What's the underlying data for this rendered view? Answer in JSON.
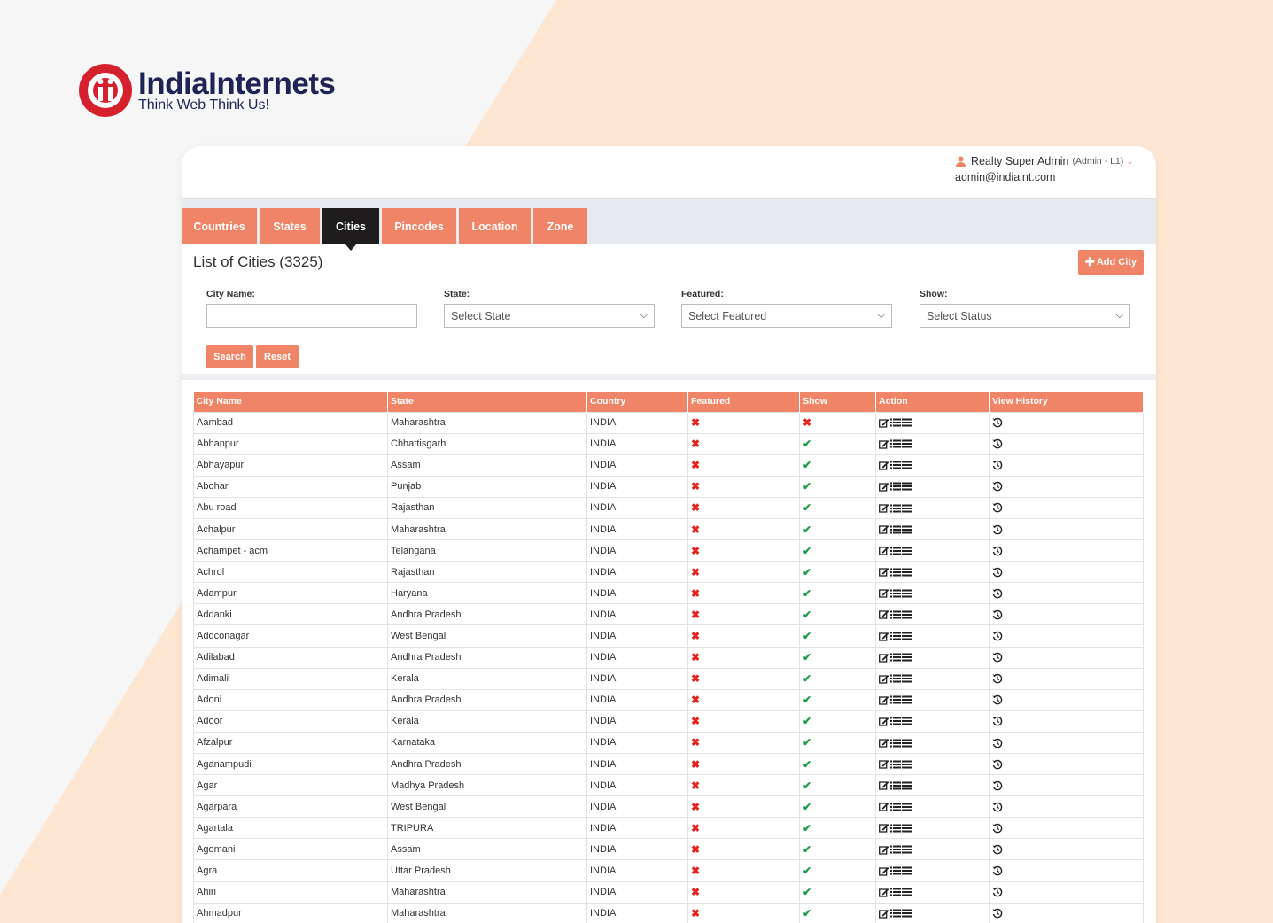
{
  "brand": {
    "name": "IndiaInternets",
    "tagline": "Think Web Think Us!"
  },
  "user": {
    "name": "Realty Super Admin",
    "role": "(Admin - L1)",
    "email": "admin@indiaint.com"
  },
  "tabs": [
    "Countries",
    "States",
    "Cities",
    "Pincodes",
    "Location",
    "Zone"
  ],
  "active_tab": "Cities",
  "page": {
    "title": "List of Cities (3325)",
    "add_button": "Add City"
  },
  "filters": {
    "city_name": {
      "label": "City Name:",
      "value": ""
    },
    "state": {
      "label": "State:",
      "value": "Select State"
    },
    "featured": {
      "label": "Featured:",
      "value": "Select Featured"
    },
    "show": {
      "label": "Show:",
      "value": "Select Status"
    }
  },
  "buttons": {
    "search": "Search",
    "reset": "Reset"
  },
  "table": {
    "headers": [
      "City Name",
      "State",
      "Country",
      "Featured",
      "Show",
      "Action",
      "View History"
    ],
    "rows": [
      {
        "city": "Aambad",
        "state": "Maharashtra",
        "country": "INDIA",
        "featured": false,
        "show": false
      },
      {
        "city": "Abhanpur",
        "state": "Chhattisgarh",
        "country": "INDIA",
        "featured": false,
        "show": true
      },
      {
        "city": "Abhayapuri",
        "state": "Assam",
        "country": "INDIA",
        "featured": false,
        "show": true
      },
      {
        "city": "Abohar",
        "state": "Punjab",
        "country": "INDIA",
        "featured": false,
        "show": true
      },
      {
        "city": "Abu road",
        "state": "Rajasthan",
        "country": "INDIA",
        "featured": false,
        "show": true
      },
      {
        "city": "Achalpur",
        "state": "Maharashtra",
        "country": "INDIA",
        "featured": false,
        "show": true
      },
      {
        "city": "Achampet - acm",
        "state": "Telangana",
        "country": "INDIA",
        "featured": false,
        "show": true
      },
      {
        "city": "Achrol",
        "state": "Rajasthan",
        "country": "INDIA",
        "featured": false,
        "show": true
      },
      {
        "city": "Adampur",
        "state": "Haryana",
        "country": "INDIA",
        "featured": false,
        "show": true
      },
      {
        "city": "Addanki",
        "state": "Andhra Pradesh",
        "country": "INDIA",
        "featured": false,
        "show": true
      },
      {
        "city": "Addconagar",
        "state": "West Bengal",
        "country": "INDIA",
        "featured": false,
        "show": true
      },
      {
        "city": "Adilabad",
        "state": "Andhra Pradesh",
        "country": "INDIA",
        "featured": false,
        "show": true
      },
      {
        "city": "Adimali",
        "state": "Kerala",
        "country": "INDIA",
        "featured": false,
        "show": true
      },
      {
        "city": "Adoni",
        "state": "Andhra Pradesh",
        "country": "INDIA",
        "featured": false,
        "show": true
      },
      {
        "city": "Adoor",
        "state": "Kerala",
        "country": "INDIA",
        "featured": false,
        "show": true
      },
      {
        "city": "Afzalpur",
        "state": "Karnataka",
        "country": "INDIA",
        "featured": false,
        "show": true
      },
      {
        "city": "Aganampudi",
        "state": "Andhra Pradesh",
        "country": "INDIA",
        "featured": false,
        "show": true
      },
      {
        "city": "Agar",
        "state": "Madhya Pradesh",
        "country": "INDIA",
        "featured": false,
        "show": true
      },
      {
        "city": "Agarpara",
        "state": "West Bengal",
        "country": "INDIA",
        "featured": false,
        "show": true
      },
      {
        "city": "Agartala",
        "state": "TRIPURA",
        "country": "INDIA",
        "featured": false,
        "show": true
      },
      {
        "city": "Agomani",
        "state": "Assam",
        "country": "INDIA",
        "featured": false,
        "show": true
      },
      {
        "city": "Agra",
        "state": "Uttar Pradesh",
        "country": "INDIA",
        "featured": false,
        "show": true
      },
      {
        "city": "Ahiri",
        "state": "Maharashtra",
        "country": "INDIA",
        "featured": false,
        "show": true
      },
      {
        "city": "Ahmadpur",
        "state": "Maharashtra",
        "country": "INDIA",
        "featured": false,
        "show": true
      }
    ]
  },
  "colors": {
    "accent": "#f08466",
    "active_tab": "#1e1c1d",
    "cross": "#e5231f",
    "check": "#1f9b4a",
    "brand_red": "#d5212e",
    "brand_navy": "#1e2454"
  },
  "icons": {
    "featured_no": "cross-icon",
    "show_yes": "check-icon",
    "action": [
      "edit-icon",
      "list-icon",
      "list-icon"
    ],
    "history": "history-icon"
  }
}
